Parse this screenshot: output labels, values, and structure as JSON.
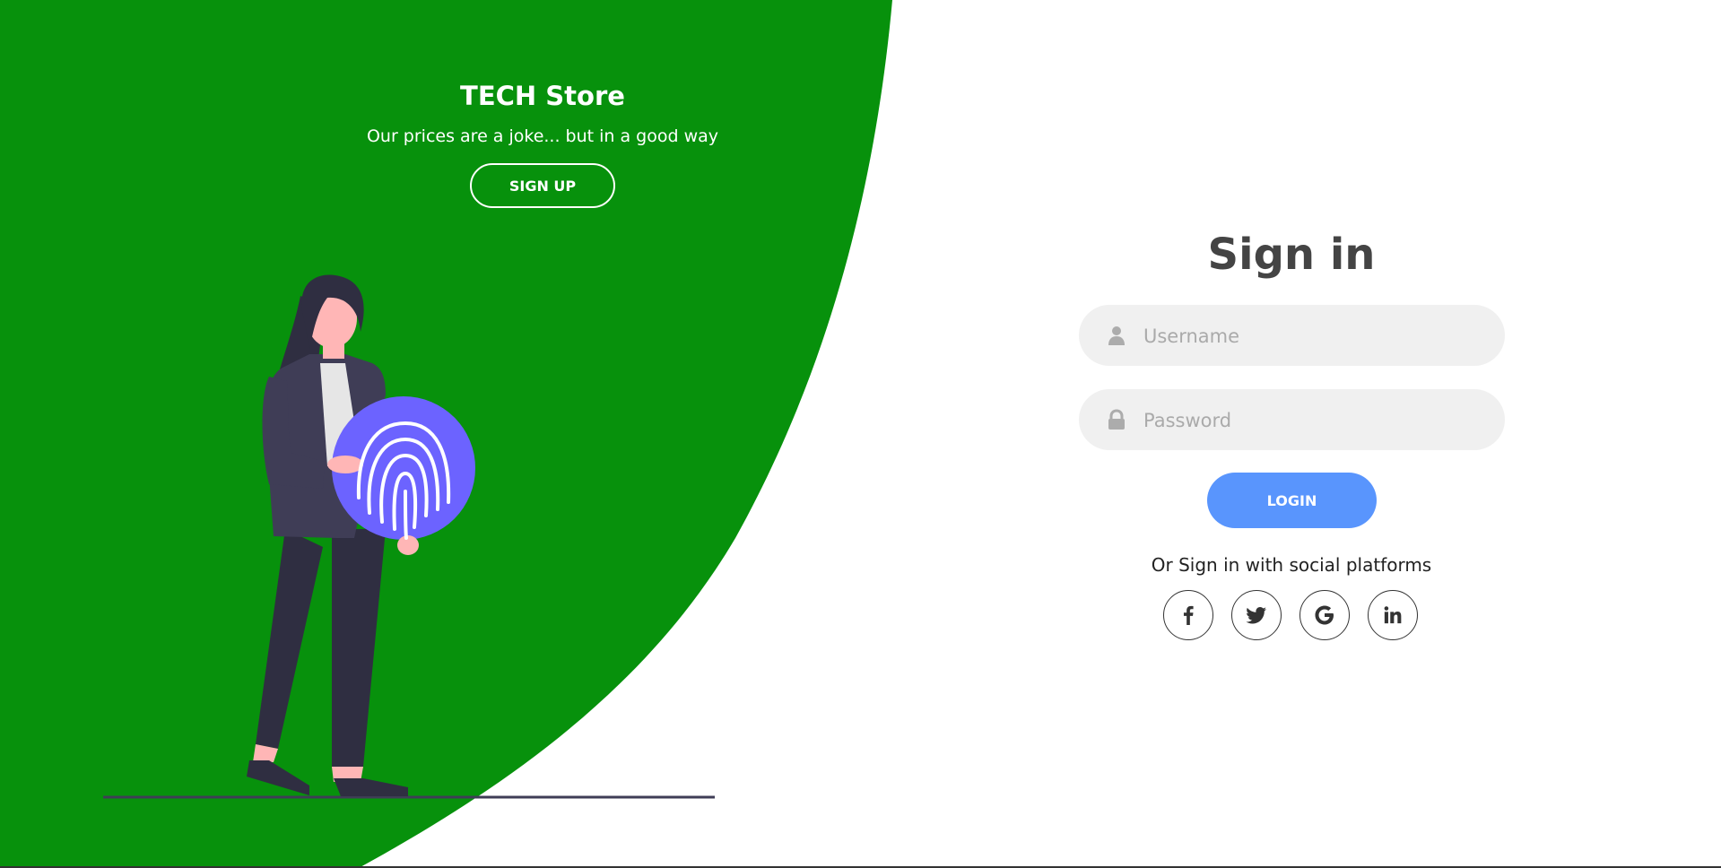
{
  "colors": {
    "panel_green": "#07910c",
    "login_blue": "#5995fd",
    "input_bg": "#f0f0f0",
    "fingerprint_purple": "#6c63ff"
  },
  "left_panel": {
    "title": "TECH Store",
    "subtitle": "Our prices are a joke... but in a good way",
    "signup_label": "SIGN UP"
  },
  "signin": {
    "title": "Sign in",
    "username_placeholder": "Username",
    "password_placeholder": "Password",
    "login_label": "LOGIN",
    "social_text": "Or Sign in with social platforms",
    "social_icons": [
      "facebook-icon",
      "twitter-icon",
      "google-icon",
      "linkedin-icon"
    ]
  }
}
